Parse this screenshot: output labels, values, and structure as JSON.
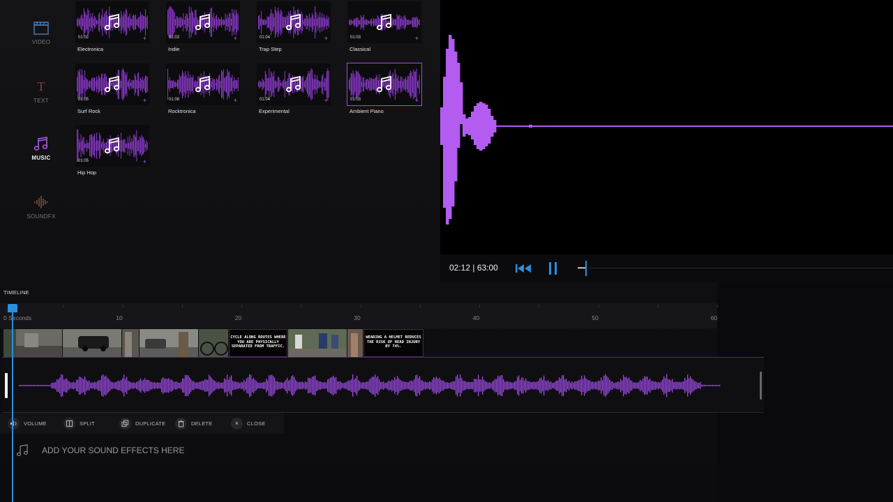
{
  "nav": [
    {
      "label": "VIDEO",
      "icon": "clapperboard-icon"
    },
    {
      "label": "TEXT",
      "icon": "text-t-icon"
    },
    {
      "label": "MUSIC",
      "icon": "music-note-icon",
      "active": true
    },
    {
      "label": "SOUNDFX",
      "icon": "soundwave-icon"
    }
  ],
  "library": [
    {
      "name": "Electronica",
      "duration": "01:02"
    },
    {
      "name": "Indie",
      "duration": "01:03"
    },
    {
      "name": "Trap Step",
      "duration": "01:04"
    },
    {
      "name": "Classical",
      "duration": "01:03"
    },
    {
      "name": "Surf Rock",
      "duration": "01:05"
    },
    {
      "name": "Rocktronica",
      "duration": "01:08"
    },
    {
      "name": "Experimental",
      "duration": "01:04"
    },
    {
      "name": "Ambient Piano",
      "duration": "01:03",
      "selected": true
    },
    {
      "name": "Hip Hop",
      "duration": "01:05"
    }
  ],
  "player": {
    "time": "02:12 | 63:00",
    "accent": "#2a8fe0",
    "wave_color": "#b35cf0"
  },
  "timeline": {
    "label": "TIMELINE",
    "first_tick": "0 Seconds",
    "ticks": [
      "10",
      "20",
      "30",
      "40",
      "50",
      "60"
    ],
    "text_clips": [
      "CYCLE ALONG ROUTES WHERE YOU ARE PHYSICALLY SEPARATED FROM TRAFFIC.",
      "WEARING A HELMET REDUCES THE RISK OF HEAD INJURY BY 74%."
    ]
  },
  "toolbar": {
    "volume": "VOLUME",
    "split": "SPLIT",
    "duplicate": "DUPLICATE",
    "delete": "DELETE",
    "close": "CLOSE",
    "close_glyph": "×"
  },
  "sfx": {
    "prompt": "ADD YOUR SOUND EFFECTS HERE"
  }
}
